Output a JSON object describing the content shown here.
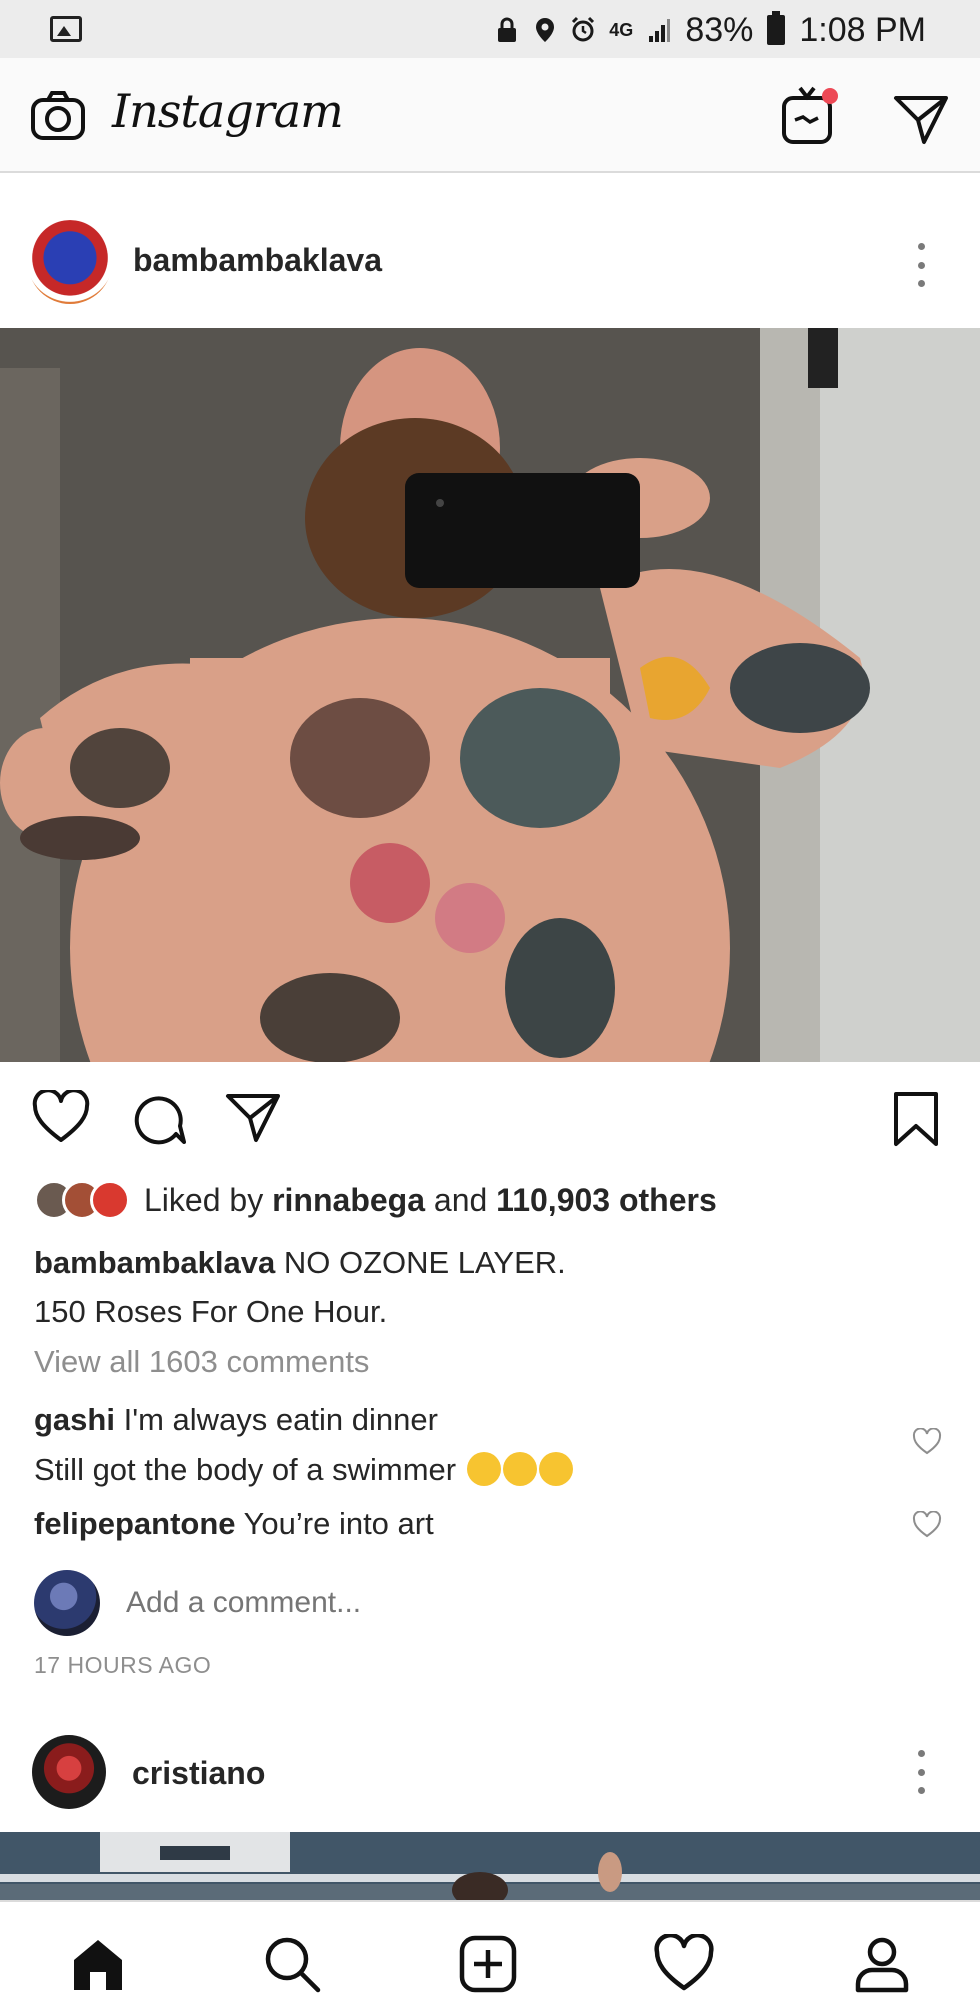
{
  "status_bar": {
    "battery": "83%",
    "time": "1:08 PM",
    "network": "4G"
  },
  "header": {
    "app_title": "Instagram"
  },
  "post": {
    "username": "bambambaklava",
    "likes_prefix": "Liked by ",
    "likes_user": "rinnabega",
    "likes_mid": " and ",
    "likes_count": "110,903 others",
    "caption_user": "bambambaklava",
    "caption_line1": " NO OZONE LAYER.",
    "caption_line2": "150 Roses For One Hour.",
    "view_all": "View all 1603 comments",
    "comments": [
      {
        "user": "gashi",
        "text_line1": " I'm always eatin dinner",
        "text_line2": "Still got the body of a swimmer"
      },
      {
        "user": "felipepantone",
        "text": " You’re into art"
      }
    ],
    "add_comment_placeholder": "Add a comment...",
    "timestamp": "17 HOURS AGO"
  },
  "next_post": {
    "username": "cristiano"
  },
  "icons": {
    "camera": "camera-icon",
    "igtv": "igtv-icon",
    "direct": "direct-message-icon",
    "like": "heart-icon",
    "comment": "comment-icon",
    "share": "paper-plane-icon",
    "save": "bookmark-icon",
    "home": "home-icon",
    "search": "search-icon",
    "new_post": "add-post-icon",
    "activity": "heart-icon",
    "profile": "profile-icon"
  },
  "colors": {
    "notification_dot": "#ed4956",
    "text_primary": "#262626",
    "text_secondary": "#8e8e8e"
  }
}
